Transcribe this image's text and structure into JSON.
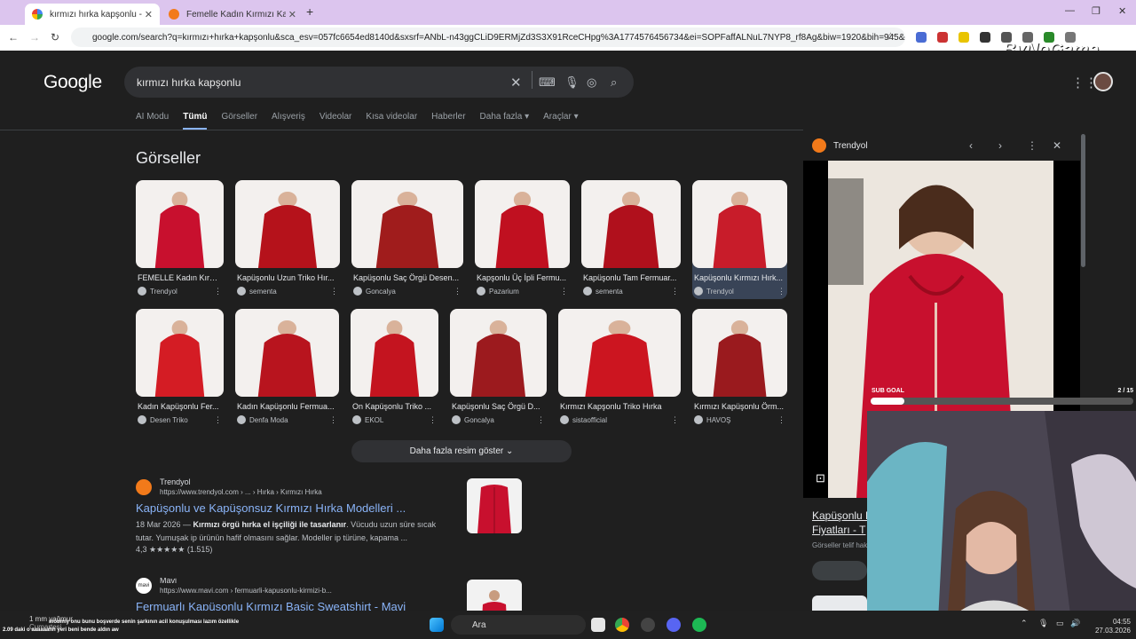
{
  "browser": {
    "tabs": [
      {
        "label": "kırmızı hırka kapşonlu - Google",
        "active": true
      },
      {
        "label": "Femelle Kadın Kırmızı Kapusonlu",
        "active": false
      }
    ],
    "url": "google.com/search?q=kırmızı+hırka+kapşonlu&sca_esv=057fc6654ed8140d&sxsrf=ANbL-n43ggCLiD9ERMjZd3S3X91RceCHpg%3A1774576456734&ei=SOPFaffALNuL7NYP8_rf8Ag&biw=1920&bih=945&oq=kırmı...",
    "overlay_brand": "ByNoGame"
  },
  "google": {
    "logo": "Google",
    "query": "kırmızı hırka kapşonlu",
    "nav": [
      "AI Modu",
      "Tümü",
      "Görseller",
      "Alışveriş",
      "Videolar",
      "Kısa videolar",
      "Haberler",
      "Daha fazla ▾",
      "Araçlar ▾"
    ],
    "images_title": "Görseller",
    "images_row1": [
      {
        "caption": "FEMELLE Kadın Kırm...",
        "source": "Trendyol",
        "color": "#c8102e"
      },
      {
        "caption": "Kapüşonlu Uzun Triko Hır...",
        "source": "sementa",
        "color": "#b5121b"
      },
      {
        "caption": "Kapüşonlu Saç Örgü Desen...",
        "source": "Goncalya",
        "color": "#a01c1c"
      },
      {
        "caption": "Kapşonlu Üç İpli Fermu...",
        "source": "Pazarium",
        "color": "#c01020"
      },
      {
        "caption": "Kapüşonlu Tam Fermuar...",
        "source": "sementa",
        "color": "#b0101c"
      },
      {
        "caption": "Kapüşonlu Kırmızı Hırk...",
        "source": "Trendyol",
        "color": "#c81c2a"
      }
    ],
    "images_row2": [
      {
        "caption": "Kadın Kapüşonlu Fer...",
        "source": "Desen Triko",
        "color": "#d41c24"
      },
      {
        "caption": "Kadın Kapüşonlu Fermua...",
        "source": "Denfa Moda",
        "color": "#b8141e"
      },
      {
        "caption": "On Kapüşonlu Triko ...",
        "source": "EKOL",
        "color": "#c4141f"
      },
      {
        "caption": "Kapüşonlu Saç Örgü D...",
        "source": "Goncalya",
        "color": "#9c1a1e"
      },
      {
        "caption": "Kırmızı Kapşonlu Triko Hırka",
        "source": "sistaofficial",
        "color": "#cc1520"
      },
      {
        "caption": "Kırmızı Kapüşonlu Örm...",
        "source": "HAVOŞ",
        "color": "#9a1a1e"
      }
    ],
    "more_images": "Daha fazla resim göster ⌄",
    "results": [
      {
        "site": "Trendyol",
        "url": "https://www.trendyol.com › ... › Hırka › Kırmızı Hırka",
        "title": "Kapüşonlu ve Kapüşonsuz Kırmızı Hırka Modelleri ...",
        "snippet_date": "18 Mar 2026 — ",
        "snippet_bold": "Kırmızı örgü hırka el işçiliği ile tasarlanır",
        "snippet_rest": ". Vücudu uzun süre sıcak tutar. Yumuşak ip ürünün hafif olmasını sağlar. Modeller ip türüne, kapama ...",
        "rating": "4,3 ★★★★★ (1.515)"
      },
      {
        "site": "Mavi",
        "url": "https://www.mavi.com › fermuarli-kapusonlu-kirmizi-b...",
        "title": "Fermuarlı Kapüşonlu Kırmızı Basic Sweatshirt - Mavi"
      }
    ]
  },
  "panel": {
    "source": "Trendyol",
    "title_line1": "Kapüşonlu K",
    "title_line2": "Fiyatları - T",
    "license": "Görseller telif hak"
  },
  "stream": {
    "sub_goal": "SUB GOAL",
    "sub_count": "2 / 15",
    "sub_progress": 0.13
  },
  "taskbar": {
    "search": "Ara",
    "time": "04:55",
    "date": "27.03.2026",
    "weather": "1 mm yağmur",
    "weather_sub": "Cumartesi",
    "chat_line1": "mommy onu bunu boşverde senin şarkının acil konuşulması lazım özellikle",
    "chat_line2": "2.09 daki o aaaaaahh yeri beni bende aldın aw"
  }
}
